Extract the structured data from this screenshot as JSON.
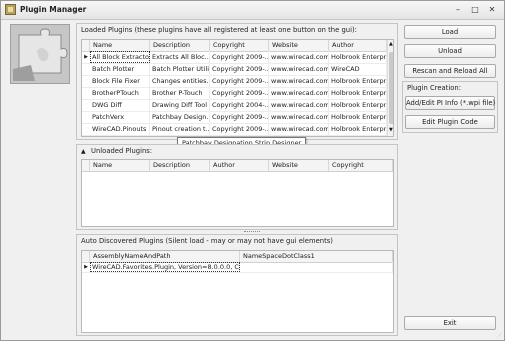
{
  "window": {
    "title": "Plugin Manager",
    "controls": [
      "–",
      "□",
      "✕"
    ]
  },
  "loaded": {
    "title": "Loaded Plugins (these plugins have all registered at least one button on the gui):",
    "columns": [
      "Name",
      "Description",
      "Copyright",
      "Website",
      "Author"
    ],
    "rows": [
      [
        "All Block Extractor",
        "Extracts All Bloc...",
        "Copyright 2009-...",
        "www.wirecad.com",
        "Holbrook Enterpr..."
      ],
      [
        "Batch Plotter",
        "Batch Plotter Utility",
        "Copyright 2009-...",
        "www.wirecad.com",
        "WireCAD"
      ],
      [
        "Block File Fixer",
        "Changes entities...",
        "Copyright 2009-...",
        "www.wirecad.com",
        "Holbrook Enterpr..."
      ],
      [
        "BrotherPTouch",
        "Brother P-Touch",
        "Copyright 2009-...",
        "www.wirecad.com",
        "Holbrook Enterpr..."
      ],
      [
        "DWG Diff",
        "Drawing Diff Tool",
        "Copyright 2004-...",
        "www.wirecad.com",
        "Holbrook Enterpr..."
      ],
      [
        "PatchVerx",
        "Patchbay Design...",
        "Copyright 2009-...",
        "www.wirecad.com",
        "Holbrook Enterpr..."
      ],
      [
        "WireCAD.Pinouts",
        "Pinout creation t...",
        "Copyright 2009-...",
        "www.wirecad.com",
        "Holbrook Enterpr..."
      ]
    ],
    "tooltip": "Patchbay Designation Strip Designer"
  },
  "unloaded": {
    "title": "Unloaded Plugins:",
    "columns": [
      "Name",
      "Description",
      "Author",
      "Website",
      "Copyright"
    ]
  },
  "auto": {
    "title": "Auto Discovered Plugins (Silent load - may or may not have gui elements)",
    "columns": [
      "AssemblyNameAndPath",
      "NameSpaceDotClass1"
    ],
    "rows": [
      [
        "WireCAD.Favorites.Plugin, Version=8.0.0.0, Cult...",
        ""
      ]
    ]
  },
  "buttons": {
    "load": "Load",
    "unload": "Unload",
    "rescan": "Rescan and Reload All",
    "creation_title": "Plugin Creation:",
    "add_edit": "Add/Edit PI Info (*.wpi file)",
    "edit_code": "Edit Plugin Code",
    "exit": "Exit"
  }
}
